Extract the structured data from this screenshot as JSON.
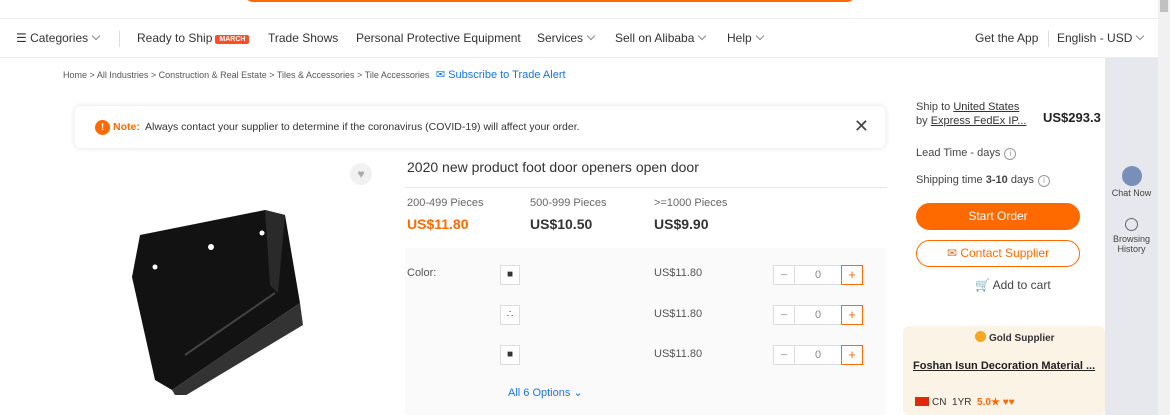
{
  "top": {
    "fragment_right": ""
  },
  "nav": {
    "categories": "Categories",
    "ready_to_ship": "Ready to Ship",
    "ready_badge": "MARCH",
    "trade_shows": "Trade Shows",
    "ppe": "Personal Protective Equipment",
    "services": "Services",
    "sell": "Sell on Alibaba",
    "help": "Help",
    "get_app": "Get the App",
    "lang_currency": "English - USD"
  },
  "breadcrumb": {
    "items": [
      "Home",
      "All Industries",
      "Construction & Real Estate",
      "Tiles & Accessories",
      "Tile Accessories"
    ],
    "separator": ">",
    "subscribe": "Subscribe to Trade Alert"
  },
  "notice": {
    "label": "Note:",
    "text": "Always contact your supplier to determine if the coronavirus (COVID-19) will affect your order."
  },
  "product": {
    "title": "2020 new product foot door openers open door",
    "tiers": [
      {
        "qty": "200-499 Pieces",
        "price": "US$11.80"
      },
      {
        "qty": "500-999 Pieces",
        "price": "US$10.50"
      },
      {
        "qty": ">=1000 Pieces",
        "price": "US$9.90"
      }
    ],
    "option_label": "Color:",
    "options": [
      {
        "price": "US$11.80",
        "qty": "0"
      },
      {
        "price": "US$11.80",
        "qty": "0"
      },
      {
        "price": "US$11.80",
        "qty": "0"
      }
    ],
    "all_options": "All 6 Options"
  },
  "shipping": {
    "ship_to_prefix": "Ship to",
    "destination": "United States",
    "by_prefix": "by",
    "method": "Express FedEx IP...",
    "total": "US$293.3",
    "lead_time": "Lead Time - days",
    "shipping_time_prefix": "Shipping time",
    "shipping_time_days": "3-10",
    "shipping_time_suffix": "days"
  },
  "actions": {
    "start_order": "Start Order",
    "contact_supplier": "Contact Supplier",
    "add_to_cart": "Add to cart"
  },
  "supplier": {
    "badge": "Gold Supplier",
    "name": "Foshan Isun Decoration Material ...",
    "country": "CN",
    "years": "1YR",
    "rating": "5.0"
  },
  "sidebar": {
    "chat": "Chat Now",
    "history": "Browsing History"
  },
  "colors": {
    "accent": "#ff6a00",
    "link": "#1a73e8"
  }
}
